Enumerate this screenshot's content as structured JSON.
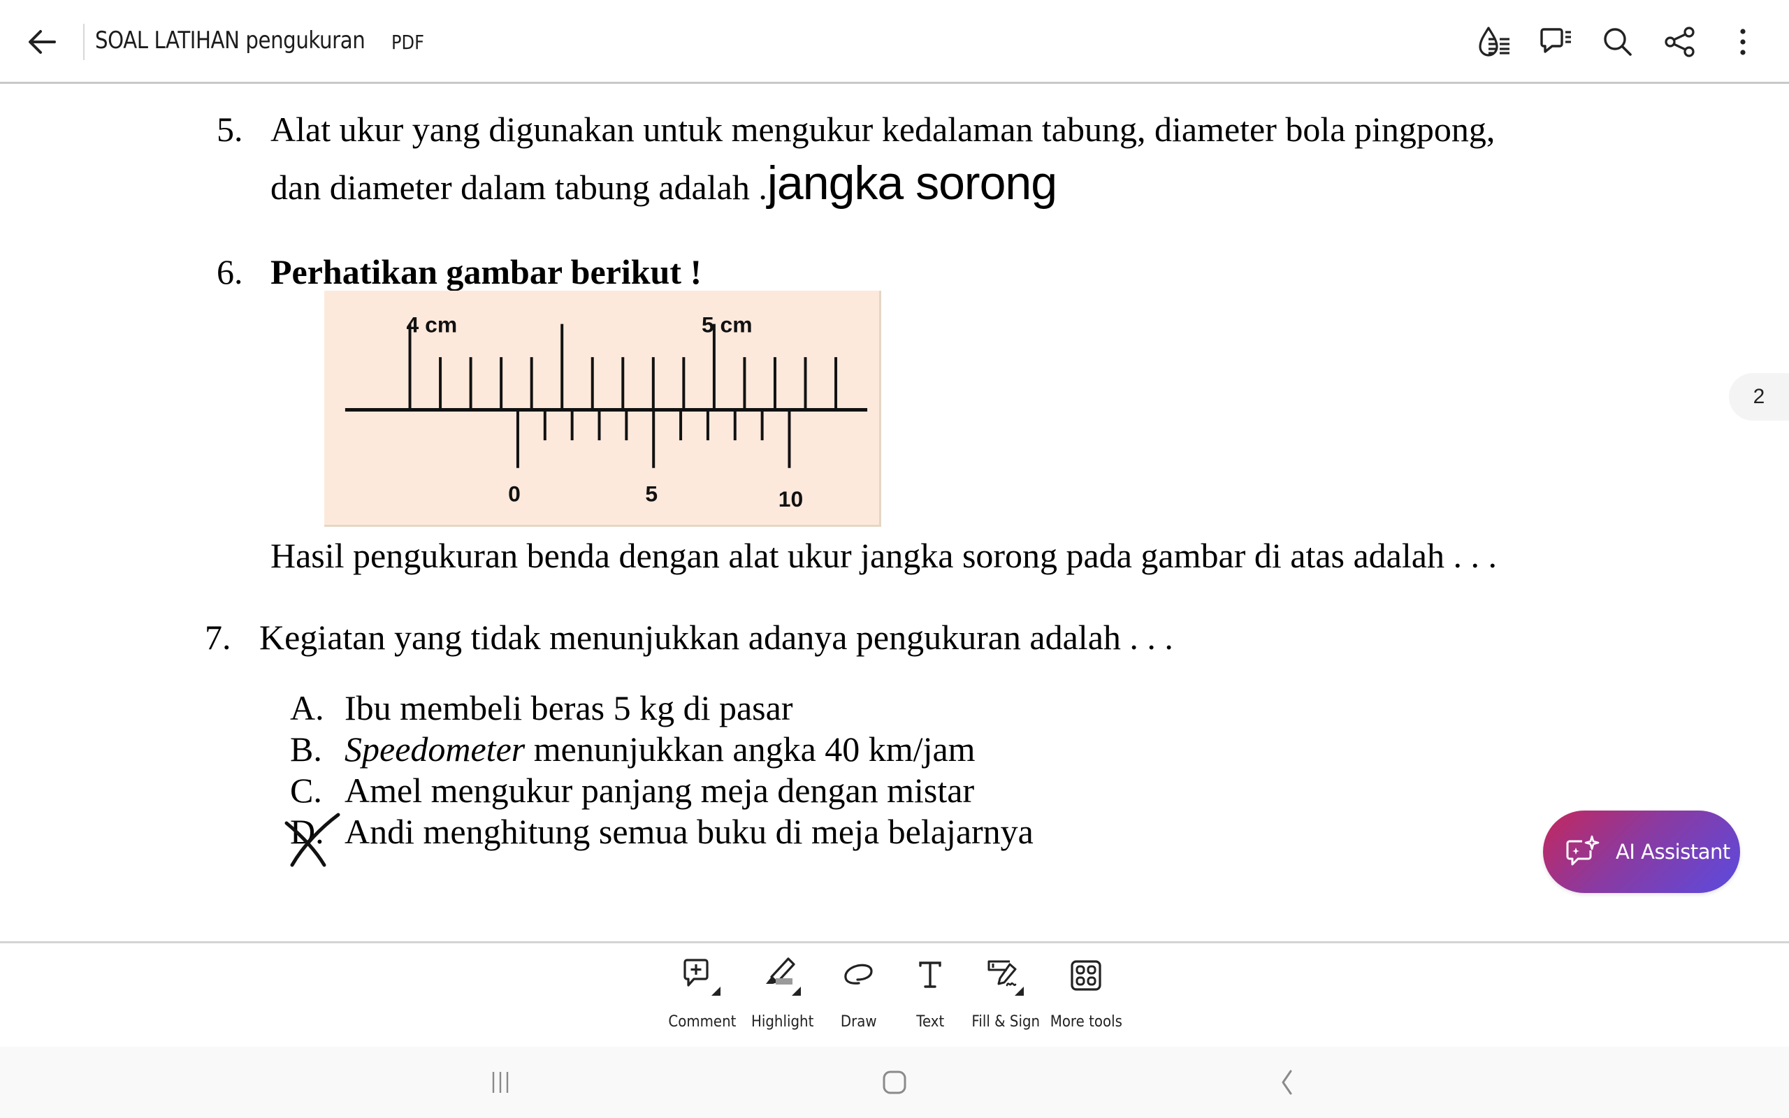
{
  "header": {
    "back_icon": "arrow-left-icon",
    "title": "SOAL LATIHAN pengukuran",
    "file_type": "PDF",
    "actions": [
      {
        "name": "liquid-mode",
        "icon": "droplet-lines-icon"
      },
      {
        "name": "comments-list",
        "icon": "speech-bubble-lines-icon"
      },
      {
        "name": "search",
        "icon": "search-icon"
      },
      {
        "name": "share",
        "icon": "share-icon"
      },
      {
        "name": "more",
        "icon": "more-vertical-icon"
      }
    ]
  },
  "document": {
    "q5": {
      "number": "5.",
      "line1": "Alat ukur yang digunakan untuk mengukur kedalaman tabung, diameter bola pingpong,",
      "line2": "dan diameter dalam tabung adalah .",
      "answer_annotation": "jangka sorong"
    },
    "q6": {
      "number": "6.",
      "title": "Perhatikan gambar berikut !",
      "figure": {
        "main_scale_labels": [
          "4 cm",
          "5 cm"
        ],
        "vernier_labels": [
          "0",
          "5",
          "10"
        ],
        "background": "#fde9dc"
      },
      "question": "Hasil pengukuran benda dengan alat ukur jangka sorong pada gambar di atas adalah . . ."
    },
    "q7": {
      "number": "7.",
      "question": "Kegiatan yang tidak menunjukkan adanya pengukuran adalah . . .",
      "options": [
        {
          "letter": "A.",
          "text": "Ibu membeli beras 5 kg di pasar"
        },
        {
          "letter": "B.",
          "italic_prefix": "Speedometer",
          "text": " menunjukkan angka 40 km/jam"
        },
        {
          "letter": "C.",
          "text": "Amel mengukur panjang meja dengan mistar"
        },
        {
          "letter": "D.",
          "text": "Andi menghitung semua buku di meja belajarnya",
          "marked": true
        }
      ]
    }
  },
  "page_indicator": "2",
  "ai_assistant": {
    "label": "AI Assistant",
    "gradient": [
      "#c4275d",
      "#5a4be0"
    ]
  },
  "toolbar": {
    "tools": [
      {
        "label": "Comment",
        "icon": "comment-add-icon"
      },
      {
        "label": "Highlight",
        "icon": "highlighter-icon"
      },
      {
        "label": "Draw",
        "icon": "draw-icon"
      },
      {
        "label": "Text",
        "icon": "text-icon"
      },
      {
        "label": "Fill & Sign",
        "icon": "fill-sign-icon"
      },
      {
        "label": "More tools",
        "icon": "more-tools-icon"
      }
    ]
  },
  "system_nav": [
    "recent-apps",
    "home",
    "back"
  ]
}
